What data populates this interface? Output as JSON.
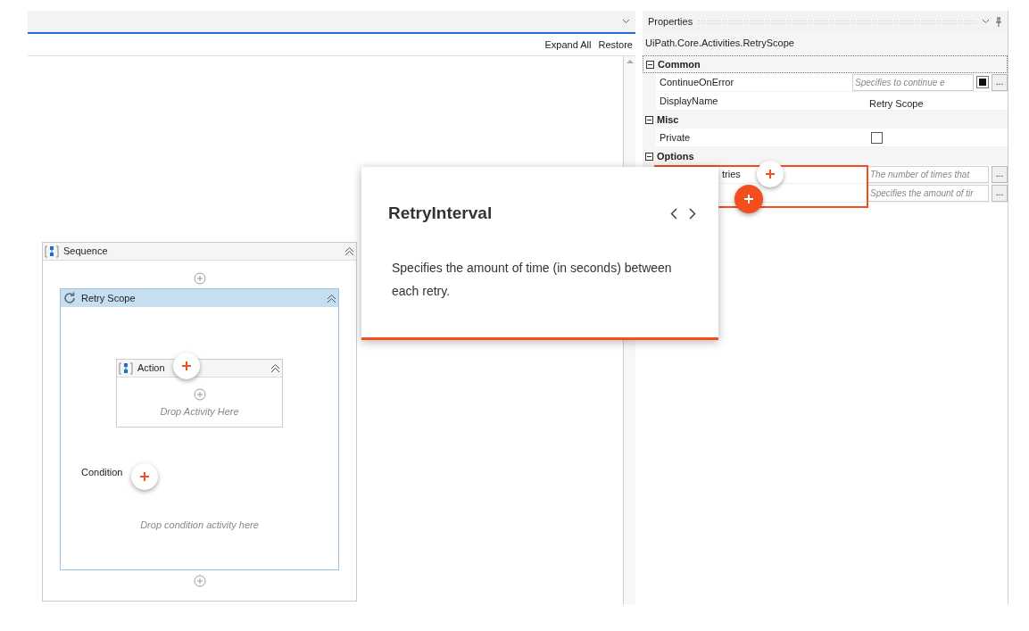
{
  "designer": {
    "toolbar_links": [
      "Expand All",
      "Restore"
    ],
    "sequence": {
      "title": "Sequence"
    },
    "retry_scope": {
      "title": "Retry Scope",
      "selected": true
    },
    "action": {
      "title": "Action",
      "hint": "Drop Activity Here"
    },
    "condition": {
      "label": "Condition",
      "hint": "Drop condition activity here"
    }
  },
  "properties": {
    "title": "Properties",
    "type_name": "UiPath.Core.Activities.RetryScope",
    "categories": [
      {
        "name": "Common",
        "expanded": true,
        "rows": [
          {
            "name": "ContinueOnError",
            "kind": "expression",
            "placeholder": "Specifies to continue e",
            "toggle": true,
            "more": "..."
          },
          {
            "name": "DisplayName",
            "kind": "text",
            "value": "Retry Scope"
          }
        ]
      },
      {
        "name": "Misc",
        "expanded": true,
        "rows": [
          {
            "name": "Private",
            "kind": "checkbox",
            "checked": false
          }
        ]
      },
      {
        "name": "Options",
        "expanded": true,
        "rows": [
          {
            "name": "tries",
            "clipped": true,
            "kind": "expression",
            "placeholder": "The number of times that",
            "more": "..."
          },
          {
            "kind": "expression",
            "placeholder": "Specifies the amount of tir",
            "more": "..."
          }
        ]
      }
    ]
  },
  "tour": {
    "title": "RetryInterval",
    "body": "Specifies the amount of time (in seconds) between each retry.",
    "highlight": true
  }
}
